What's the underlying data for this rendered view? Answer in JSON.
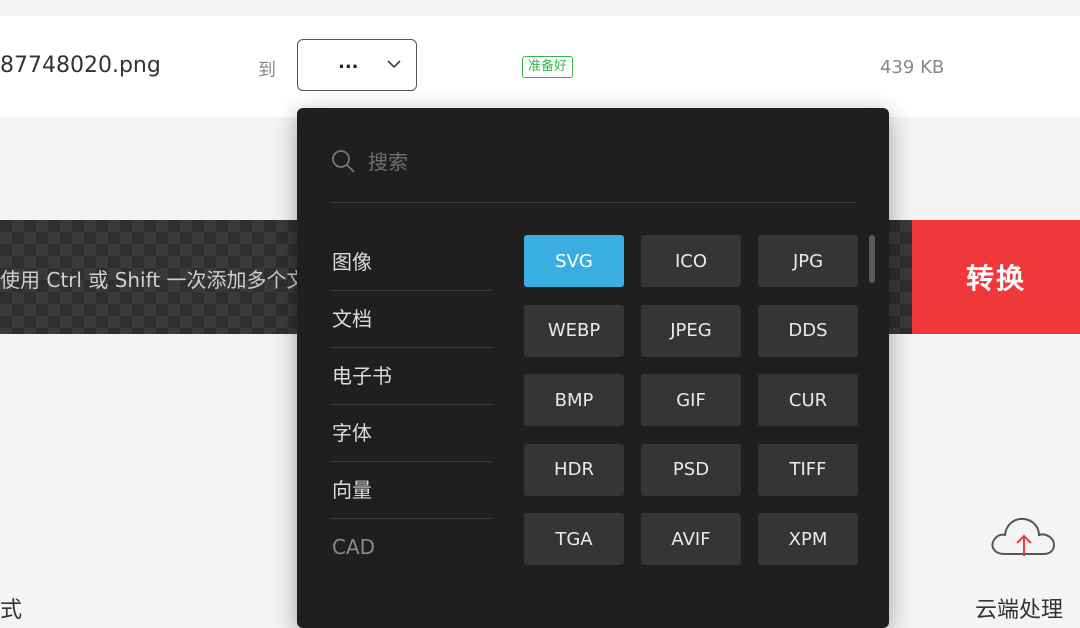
{
  "file": {
    "name": "87748020.png",
    "to_label": "到",
    "selected_format": "...",
    "status": "准备好",
    "size": "439 KB"
  },
  "drop": {
    "hint": "使用 Ctrl 或 Shift 一次添加多个文件"
  },
  "convert_label": "转换",
  "cloud_label": "云端处理",
  "left_fragment": "式",
  "dropdown": {
    "search_placeholder": "搜索",
    "categories": [
      "图像",
      "文档",
      "电子书",
      "字体",
      "向量",
      "CAD"
    ],
    "formats": [
      "SVG",
      "ICO",
      "JPG",
      "WEBP",
      "JPEG",
      "DDS",
      "BMP",
      "GIF",
      "CUR",
      "HDR",
      "PSD",
      "TIFF",
      "TGA",
      "AVIF",
      "XPM"
    ],
    "active_format": "SVG"
  },
  "colors": {
    "accent_blue": "#3aaee0",
    "convert_red": "#f0373a",
    "status_green": "#39b54a"
  },
  "icons": {
    "search": "search-icon",
    "chevron": "chevron-down-icon",
    "cloud": "cloud-upload-icon"
  }
}
